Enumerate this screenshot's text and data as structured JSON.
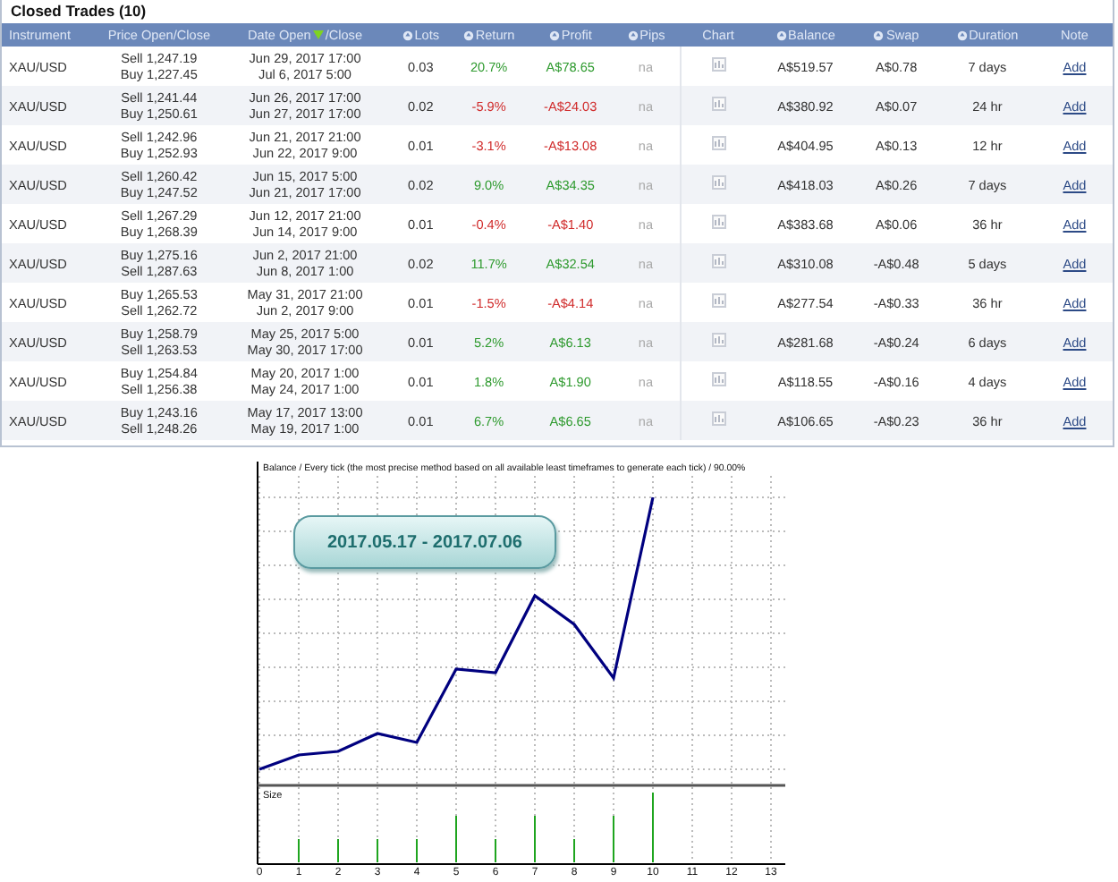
{
  "panel": {
    "title": "Closed Trades (10)"
  },
  "columns": [
    {
      "label": "Instrument",
      "sortable": false,
      "sorted": false
    },
    {
      "label": "Price Open/Close",
      "sortable": false,
      "sorted": false
    },
    {
      "label": "Date Open",
      "suffix": "/Close",
      "sortable": false,
      "sorted": true
    },
    {
      "label": "Lots",
      "sortable": true,
      "sorted": false
    },
    {
      "label": "Return",
      "sortable": true,
      "sorted": false
    },
    {
      "label": "Profit",
      "sortable": true,
      "sorted": false
    },
    {
      "label": "Pips",
      "sortable": true,
      "sorted": false
    },
    {
      "label": "Chart",
      "sortable": false,
      "sorted": false
    },
    {
      "label": "Balance",
      "sortable": true,
      "sorted": false
    },
    {
      "label": "Swap",
      "sortable": true,
      "sorted": false
    },
    {
      "label": "Duration",
      "sortable": true,
      "sorted": false
    },
    {
      "label": "Note",
      "sortable": false,
      "sorted": false
    }
  ],
  "rows": [
    {
      "instrument": "XAU/USD",
      "open_price": "Sell 1,247.19",
      "close_price": "Buy 1,227.45",
      "open_date": "Jun 29, 2017 17:00",
      "close_date": "Jul 6, 2017 5:00",
      "lots": "0.03",
      "return": "20.7%",
      "profit": "A$78.65",
      "kind": "gain",
      "pips": "na",
      "balance": "A$519.57",
      "swap": "A$0.78",
      "duration": "7 days",
      "note": "Add"
    },
    {
      "instrument": "XAU/USD",
      "open_price": "Sell 1,241.44",
      "close_price": "Buy 1,250.61",
      "open_date": "Jun 26, 2017 17:00",
      "close_date": "Jun 27, 2017 17:00",
      "lots": "0.02",
      "return": "-5.9%",
      "profit": "-A$24.03",
      "kind": "loss",
      "pips": "na",
      "balance": "A$380.92",
      "swap": "A$0.07",
      "duration": "24 hr",
      "note": "Add"
    },
    {
      "instrument": "XAU/USD",
      "open_price": "Sell 1,242.96",
      "close_price": "Buy 1,252.93",
      "open_date": "Jun 21, 2017 21:00",
      "close_date": "Jun 22, 2017 9:00",
      "lots": "0.01",
      "return": "-3.1%",
      "profit": "-A$13.08",
      "kind": "loss",
      "pips": "na",
      "balance": "A$404.95",
      "swap": "A$0.13",
      "duration": "12 hr",
      "note": "Add"
    },
    {
      "instrument": "XAU/USD",
      "open_price": "Sell 1,260.42",
      "close_price": "Buy 1,247.52",
      "open_date": "Jun 15, 2017 5:00",
      "close_date": "Jun 21, 2017 17:00",
      "lots": "0.02",
      "return": "9.0%",
      "profit": "A$34.35",
      "kind": "gain",
      "pips": "na",
      "balance": "A$418.03",
      "swap": "A$0.26",
      "duration": "7 days",
      "note": "Add"
    },
    {
      "instrument": "XAU/USD",
      "open_price": "Sell 1,267.29",
      "close_price": "Buy 1,268.39",
      "open_date": "Jun 12, 2017 21:00",
      "close_date": "Jun 14, 2017 9:00",
      "lots": "0.01",
      "return": "-0.4%",
      "profit": "-A$1.40",
      "kind": "loss",
      "pips": "na",
      "balance": "A$383.68",
      "swap": "A$0.06",
      "duration": "36 hr",
      "note": "Add"
    },
    {
      "instrument": "XAU/USD",
      "open_price": "Buy 1,275.16",
      "close_price": "Sell 1,287.63",
      "open_date": "Jun 2, 2017 21:00",
      "close_date": "Jun 8, 2017 1:00",
      "lots": "0.02",
      "return": "11.7%",
      "profit": "A$32.54",
      "kind": "gain",
      "pips": "na",
      "balance": "A$310.08",
      "swap": "-A$0.48",
      "duration": "5 days",
      "note": "Add"
    },
    {
      "instrument": "XAU/USD",
      "open_price": "Buy 1,265.53",
      "close_price": "Sell 1,262.72",
      "open_date": "May 31, 2017 21:00",
      "close_date": "Jun 2, 2017 9:00",
      "lots": "0.01",
      "return": "-1.5%",
      "profit": "-A$4.14",
      "kind": "loss",
      "pips": "na",
      "balance": "A$277.54",
      "swap": "-A$0.33",
      "duration": "36 hr",
      "note": "Add"
    },
    {
      "instrument": "XAU/USD",
      "open_price": "Buy 1,258.79",
      "close_price": "Sell 1,263.53",
      "open_date": "May 25, 2017 5:00",
      "close_date": "May 30, 2017 17:00",
      "lots": "0.01",
      "return": "5.2%",
      "profit": "A$6.13",
      "kind": "gain",
      "pips": "na",
      "balance": "A$281.68",
      "swap": "-A$0.24",
      "duration": "6 days",
      "note": "Add"
    },
    {
      "instrument": "XAU/USD",
      "open_price": "Buy 1,254.84",
      "close_price": "Sell 1,256.38",
      "open_date": "May 20, 2017 1:00",
      "close_date": "May 24, 2017 1:00",
      "lots": "0.01",
      "return": "1.8%",
      "profit": "A$1.90",
      "kind": "gain",
      "pips": "na",
      "balance": "A$118.55",
      "swap": "-A$0.16",
      "duration": "4 days",
      "note": "Add"
    },
    {
      "instrument": "XAU/USD",
      "open_price": "Buy 1,243.16",
      "close_price": "Sell 1,248.26",
      "open_date": "May 17, 2017 13:00",
      "close_date": "May 19, 2017 1:00",
      "lots": "0.01",
      "return": "6.7%",
      "profit": "A$6.65",
      "kind": "gain",
      "pips": "na",
      "balance": "A$106.65",
      "swap": "-A$0.23",
      "duration": "36 hr",
      "note": "Add"
    }
  ],
  "report_chart": {
    "title": "Balance / Every tick (the most precise method based on all available least timeframes to generate each tick) / 90.00%",
    "period": "2017.05.17 - 2017.07.06",
    "size_label": "Size",
    "x_ticks": [
      "0",
      "1",
      "2",
      "3",
      "4",
      "5",
      "6",
      "7",
      "8",
      "9",
      "10",
      "11",
      "12",
      "13"
    ]
  }
}
